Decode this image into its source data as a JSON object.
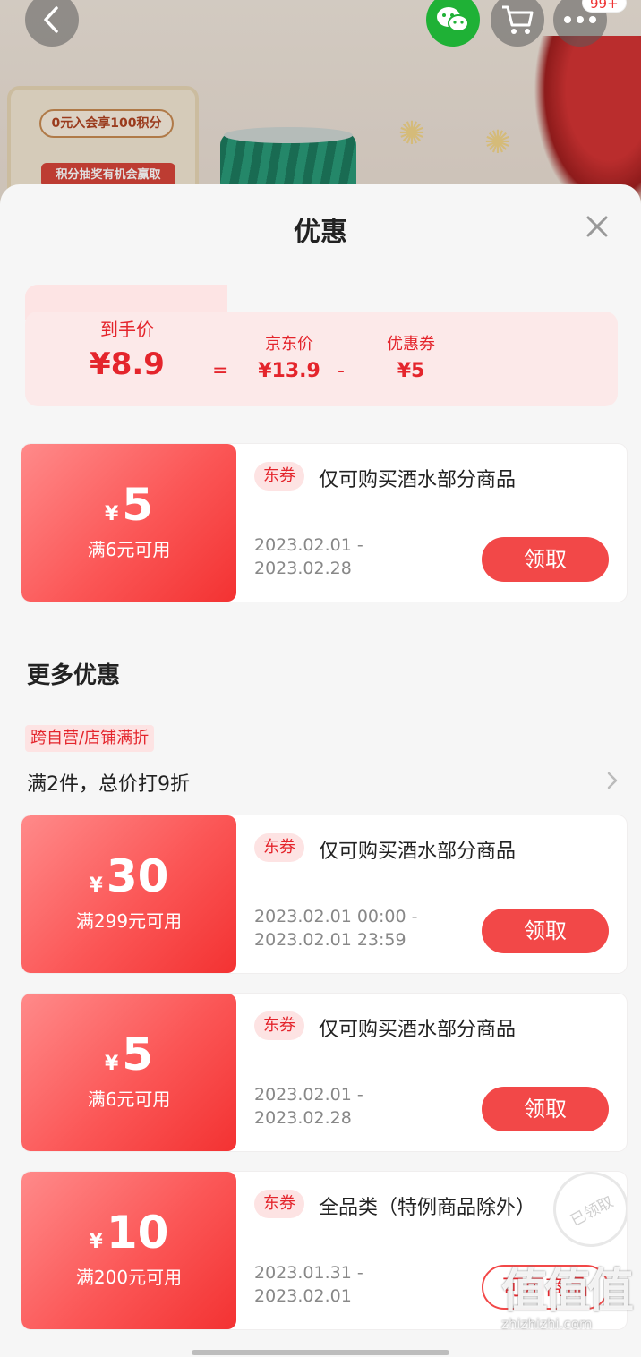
{
  "background": {
    "badge": "99+",
    "promo_line1": "0元入会享100积分",
    "promo_line2": "积分抽奖有机会赢取"
  },
  "sheet": {
    "title": "优惠",
    "price_summary": {
      "final_label": "到手价",
      "final_value": "¥8.9",
      "equals": "=",
      "jd_label": "京东价",
      "jd_value": "¥13.9",
      "minus": "-",
      "coupon_label": "优惠券",
      "coupon_value": "¥5"
    },
    "coupons": [
      {
        "yen": "¥",
        "amount": "5",
        "condition": "满6元可用",
        "tag": "东券",
        "description": "仅可购买酒水部分商品",
        "date_start": "2023.02.01  -",
        "date_end": "2023.02.28",
        "button": "领取"
      }
    ],
    "more_title": "更多优惠",
    "discount": {
      "tag": "跨自营/店铺满折",
      "text": "满2件，总价打9折"
    },
    "more_coupons": [
      {
        "yen": "¥",
        "amount": "30",
        "condition": "满299元可用",
        "tag": "东券",
        "description": "仅可购买酒水部分商品",
        "date_start": "2023.02.01  00:00  -",
        "date_end": "2023.02.01  23:59",
        "button": "领取"
      },
      {
        "yen": "¥",
        "amount": "5",
        "condition": "满6元可用",
        "tag": "东券",
        "description": "仅可购买酒水部分商品",
        "date_start": "2023.02.01  -",
        "date_end": "2023.02.28",
        "button": "领取"
      },
      {
        "yen": "¥",
        "amount": "10",
        "condition": "满200元可用",
        "tag": "东券",
        "description": "全品类（特例商品除外）",
        "date_start": "2023.01.31  -",
        "date_end": "2023.02.01",
        "button": "可用商品",
        "stamp": "已领取"
      }
    ]
  },
  "watermark": {
    "logo": "值值值",
    "url": "zhizhizhi.com"
  },
  "colors": {
    "accent_red": "#e4252c",
    "button_red": "#f24848",
    "wechat_green": "#1fb136"
  }
}
